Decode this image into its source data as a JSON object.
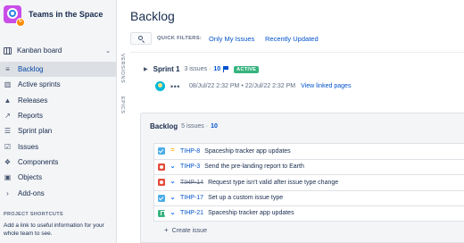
{
  "project": {
    "name": "Teams in the Space",
    "badge": "↻"
  },
  "sidebar": {
    "board_label": "Kanban board",
    "items": [
      {
        "label": "Backlog",
        "icon": "backlog-icon",
        "glyph": "≡"
      },
      {
        "label": "Active sprints",
        "icon": "active-sprints-icon",
        "glyph": "▥"
      },
      {
        "label": "Releases",
        "icon": "releases-icon",
        "glyph": "▲"
      },
      {
        "label": "Reports",
        "icon": "reports-icon",
        "glyph": "↗"
      },
      {
        "label": "Sprint plan",
        "icon": "sprint-plan-icon",
        "glyph": "☰"
      },
      {
        "label": "Issues",
        "icon": "issues-icon",
        "glyph": "☑"
      },
      {
        "label": "Components",
        "icon": "components-icon",
        "glyph": "❖"
      },
      {
        "label": "Objects",
        "icon": "objects-icon",
        "glyph": "▣"
      },
      {
        "label": "Add-ons",
        "icon": "chevron-right-icon",
        "glyph": "›"
      }
    ],
    "shortcuts_title": "PROJECT SHORTCUTS",
    "shortcuts_text": "Add a link to useful information for your whole team to see."
  },
  "rail": {
    "versions": "VERSIONS",
    "epics": "EPICS"
  },
  "main": {
    "title": "Backlog",
    "quick_filters_label": "QUICK FILTERS:",
    "quick_filters": [
      "Only My Issues",
      "Recently Updated"
    ]
  },
  "sprint": {
    "name": "Sprint 1",
    "count": "3 issues ·",
    "count_number": "10",
    "status": "ACTIVE",
    "more": "•••",
    "dates": "08/Jul/22 2:32 PM • 22/Jul/22 2:32 PM",
    "linked_pages": "View linked pages"
  },
  "backlog": {
    "title": "Backlog",
    "count": "5 issues ·",
    "count_number": "10",
    "create_label": "Create issue",
    "issues": [
      {
        "type": "task",
        "priority": "medium",
        "priority_glyph": "=",
        "key": "TIHP-8",
        "done": false,
        "summary": "Spaceship tracker app updates"
      },
      {
        "type": "bug",
        "priority": "low",
        "priority_glyph": "⌄",
        "key": "TIHP-3",
        "done": false,
        "summary": "Send the pre-landing report to Earth"
      },
      {
        "type": "bug",
        "priority": "low",
        "priority_glyph": "⌄",
        "key": "TIHP-14",
        "done": true,
        "summary": "Request type isn't valid after issue type change"
      },
      {
        "type": "task",
        "priority": "low",
        "priority_glyph": "⌄",
        "key": "TIHP-17",
        "done": false,
        "summary": "Set up a custom issue type"
      },
      {
        "type": "story",
        "priority": "low",
        "priority_glyph": "⌄",
        "key": "TIHP-21",
        "done": false,
        "summary": "Spaceship tracker app updates"
      }
    ]
  },
  "colors": {
    "accent": "#0052cc",
    "active_green": "#36b37e",
    "bug_red": "#e5493a",
    "task_blue": "#4bade8",
    "priority_medium": "#ffab00"
  }
}
